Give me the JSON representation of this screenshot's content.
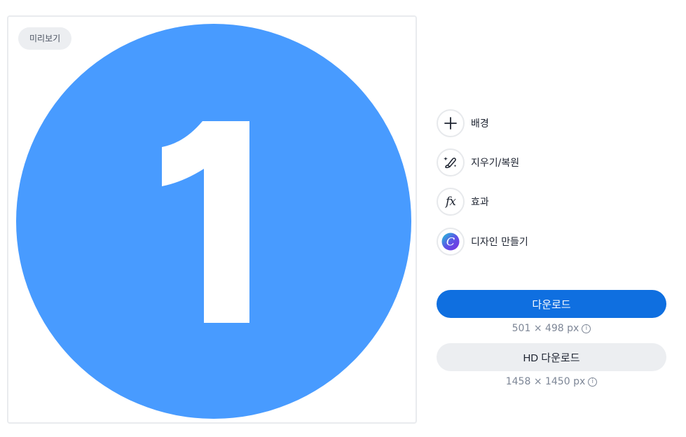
{
  "preview": {
    "badge": "미리보기",
    "image": {
      "number": "1",
      "circle_color": "#489bff",
      "number_color": "#ffffff"
    }
  },
  "tools": [
    {
      "label": "배경",
      "icon": "plus-icon"
    },
    {
      "label": "지우기/복원",
      "icon": "magic-brush-icon"
    },
    {
      "label": "효과",
      "icon": "fx-icon",
      "glyph": "fx"
    },
    {
      "label": "디자인 만들기",
      "icon": "canva-logo-icon",
      "glyph": "C"
    }
  ],
  "download": {
    "label": "다운로드",
    "size_text": "501 × 498 px",
    "color": "#0f6fe0"
  },
  "hd_download": {
    "label": "HD 다운로드",
    "size_text": "1458 × 1450 px"
  }
}
